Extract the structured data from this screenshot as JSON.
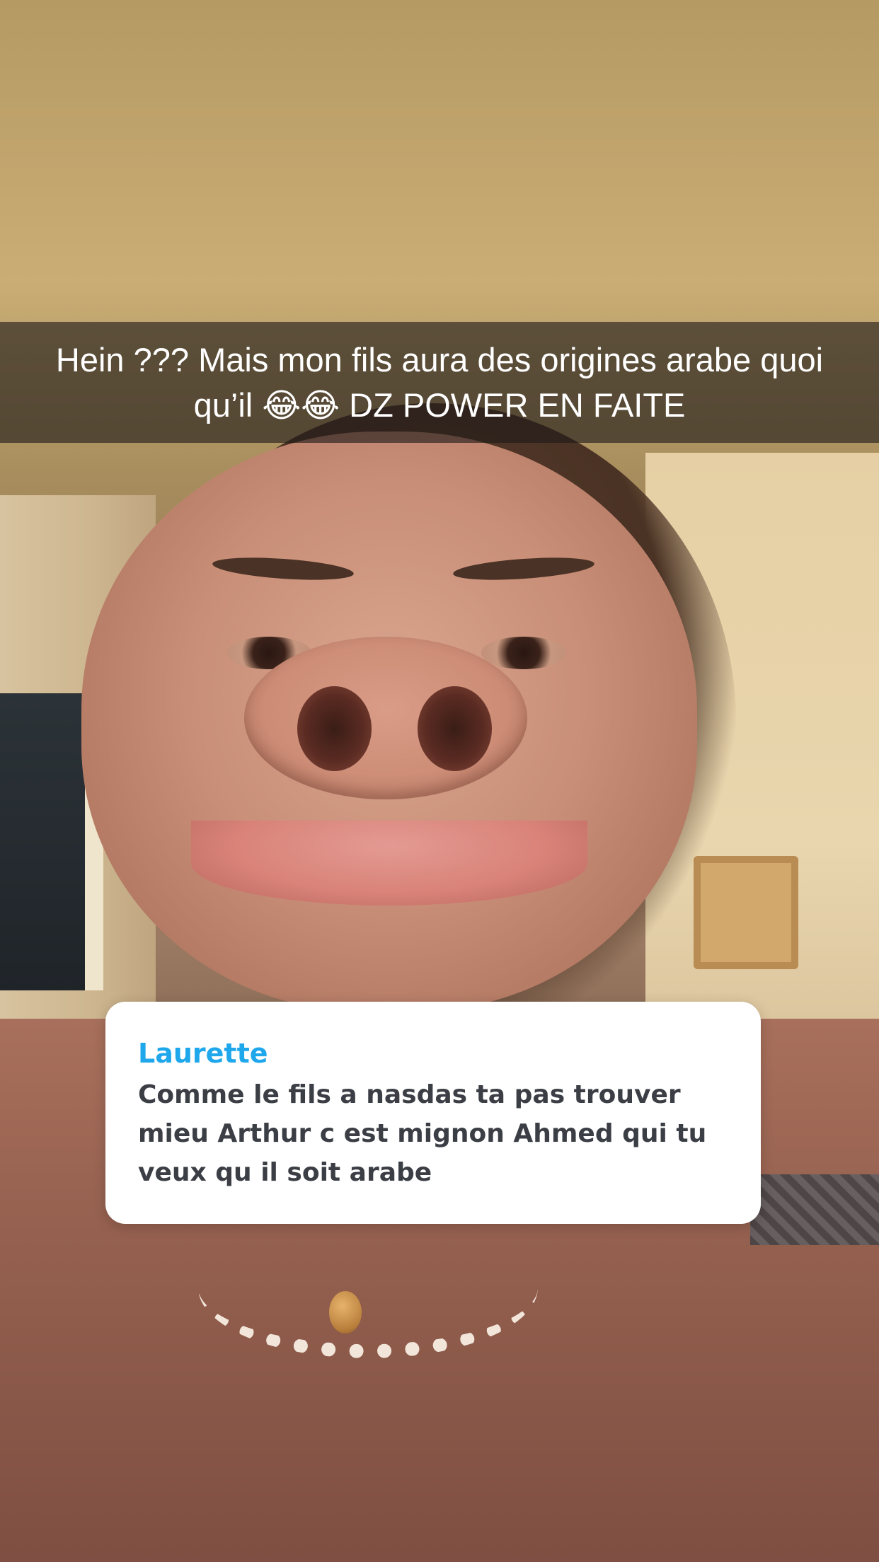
{
  "caption": {
    "text": "Hein ??? Mais mon fils aura des origines arabe quoi qu’il 😂😂 DZ POWER EN FAITE"
  },
  "question": {
    "author": "Laurette",
    "text": "Comme le fils a nasdas ta pas trouver mieu Arthur c est mignon Ahmed qui tu veux qu il soit arabe"
  },
  "colors": {
    "author_accent": "#1fa7ec",
    "card_background": "#ffffff",
    "caption_bar": "rgba(30,26,24,0.62)"
  }
}
